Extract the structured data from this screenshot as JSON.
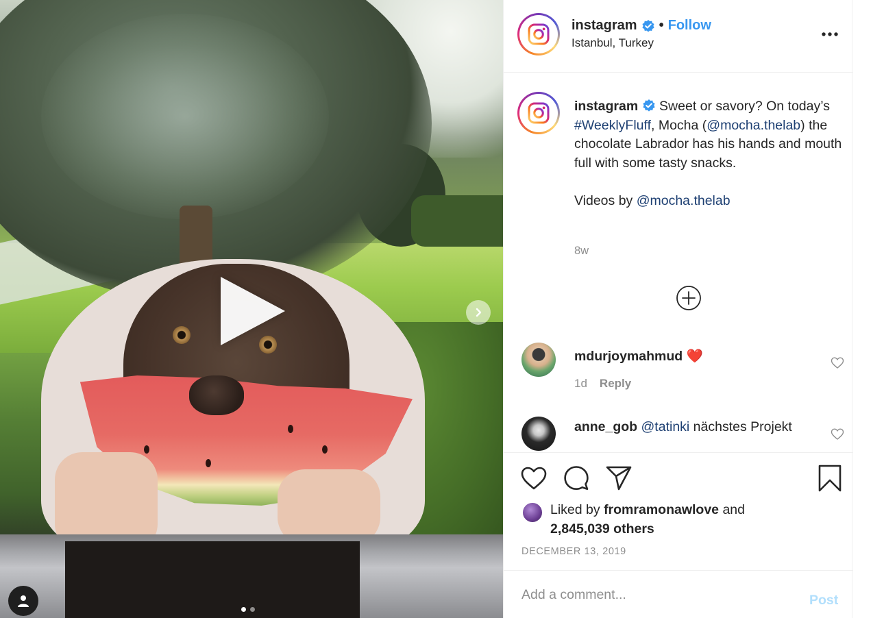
{
  "post": {
    "username": "instagram",
    "verified": true,
    "separator": "•",
    "follow_label": "Follow",
    "location": "Istanbul, Turkey",
    "more_icon": "more-horizontal-icon"
  },
  "media": {
    "play_icon": "play-icon",
    "next_icon": "chevron-right-icon",
    "carousel_count": 2,
    "carousel_active": 0,
    "tag_icon": "user-tag-icon"
  },
  "caption": {
    "username": "instagram",
    "text_1": " Sweet or savory? On today’s ",
    "hashtag": "#WeeklyFluff",
    "text_2": ", Mocha (",
    "mention_1": "@mocha.thelab",
    "text_3": ") the chocolate Labrador has his hands and mouth full with some tasty snacks.",
    "videos_by": "Videos by ",
    "mention_2": "@mocha.thelab",
    "time_ago": "8w"
  },
  "comments": [
    {
      "username": "mdurjoymahmud",
      "text": " ❤️",
      "time": "1d",
      "reply_label": "Reply"
    },
    {
      "username": "anne_gob",
      "mention": "@tatinki",
      "text": " nächstes Projekt"
    }
  ],
  "likes": {
    "prefix": "Liked by ",
    "user": "fromramonawlove",
    "middle": " and",
    "count": "2,845,039 others"
  },
  "date": "DECEMBER 13, 2019",
  "add_comment": {
    "placeholder": "Add a comment...",
    "post_label": "Post"
  },
  "colors": {
    "link": "#1d3f72",
    "follow": "#3897f0",
    "verified": "#3897f0",
    "muted": "#8e8e8e",
    "post_disabled": "#b2dffc"
  }
}
